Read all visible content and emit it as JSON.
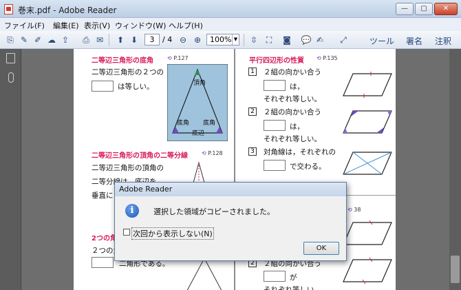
{
  "window": {
    "title": "巻末.pdf - Adobe Reader",
    "min_glyph": "—",
    "max_glyph": "▢",
    "close_glyph": "✕"
  },
  "menu": [
    "ファイル(F)",
    "編集(E)",
    "表示(V)",
    "ウィンドウ(W)",
    "ヘルプ(H)"
  ],
  "toolbar": {
    "page_current": "3",
    "page_total": "/ 4",
    "zoom": "100%",
    "tools_label": "ツール",
    "sign_label": "署名",
    "comment_label": "注釈"
  },
  "left_column": {
    "h1": "二等辺三角形の底角",
    "ref1": "P.127",
    "t1a": "二等辺三角形の２つの",
    "t1b": "は等しい。",
    "tri_apex": "頂角",
    "tri_base_angle_l": "底角",
    "tri_base_angle_r": "底角",
    "tri_base": "底辺",
    "h2": "二等辺三角形の頂角の二等分線",
    "ref2": "P.128",
    "t2a": "二等辺三角形の頂角の",
    "t2b": "二等分線は，底辺を",
    "t2c": "垂直に",
    "h3": "2つの角",
    "t3a": "２つの角",
    "t3b": "二角形である。"
  },
  "right_column": {
    "h1": "平行四辺形の性質",
    "ref1": "P.135",
    "item1_num": "1",
    "item1_a": "２組の向かい合う",
    "item1_b": "は，",
    "item1_c": "それぞれ等しい。",
    "item2_num": "2",
    "item2_a": "２組の向かい合う",
    "item2_b": "は，",
    "item2_c": "それぞれ等しい。",
    "item3_num": "3",
    "item3_a": "対角線は，それぞれの",
    "item3_b": "で交わる。",
    "ref2_fragment": "38",
    "item5_num": "2",
    "item5_a": "２組の向かい合う",
    "item5_b": "が",
    "item5_c": "それぞれ等しい"
  },
  "dialog": {
    "title": "Adobe Reader",
    "message": "選択した領域がコピーされました。",
    "checkbox_label": "次回から表示しない(N)",
    "ok": "OK"
  }
}
